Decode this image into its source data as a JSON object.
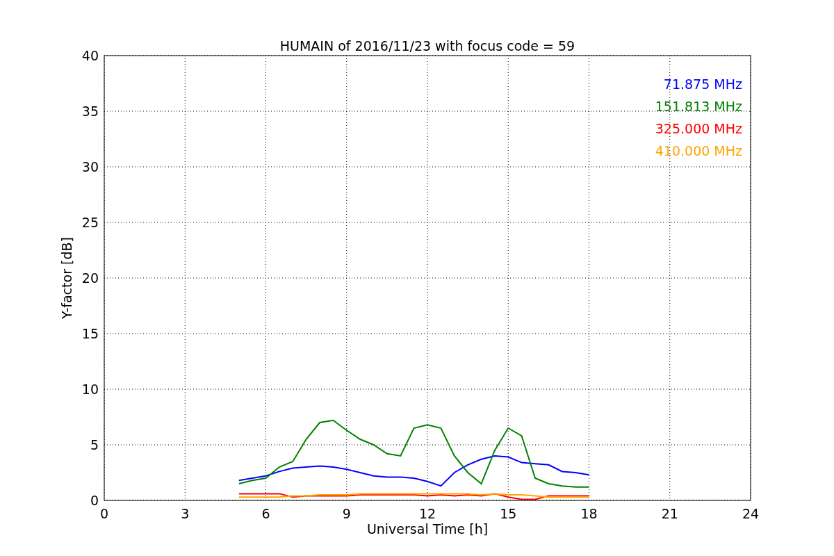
{
  "plot": {
    "chart_data": {
      "type": "line",
      "title": "HUMAIN of 2016/11/23 with focus code = 59",
      "xlabel": "Universal Time [h]",
      "ylabel": "Y-factor [dB]",
      "x": [
        5,
        5.5,
        6,
        6.5,
        7,
        7.5,
        8,
        8.5,
        9,
        9.5,
        10,
        10.5,
        11,
        11.5,
        12,
        12.5,
        13,
        13.5,
        14,
        14.5,
        15,
        15.5,
        16,
        16.5,
        17,
        17.5,
        18
      ],
      "series": [
        {
          "name": "71.875 MHz",
          "color": "#0000ff",
          "values": [
            1.8,
            2.0,
            2.2,
            2.6,
            2.9,
            3.0,
            3.1,
            3.0,
            2.8,
            2.5,
            2.2,
            2.1,
            2.1,
            2.0,
            1.7,
            1.3,
            2.5,
            3.2,
            3.7,
            4.0,
            3.9,
            3.4,
            3.3,
            3.2,
            2.6,
            2.5,
            2.3
          ]
        },
        {
          "name": "151.813 MHz",
          "color": "#008000",
          "values": [
            1.5,
            1.8,
            2.0,
            3.0,
            3.5,
            5.5,
            7.0,
            7.2,
            6.3,
            5.5,
            5.0,
            4.2,
            4.0,
            6.5,
            6.8,
            6.5,
            4.0,
            2.5,
            1.5,
            4.5,
            6.5,
            5.8,
            2.0,
            1.5,
            1.3,
            1.2,
            1.2
          ]
        },
        {
          "name": "325.000 MHz",
          "color": "#ff0000",
          "values": [
            0.6,
            0.6,
            0.6,
            0.6,
            0.3,
            0.4,
            0.4,
            0.4,
            0.4,
            0.5,
            0.5,
            0.5,
            0.5,
            0.5,
            0.4,
            0.5,
            0.4,
            0.5,
            0.4,
            0.6,
            0.3,
            0.1,
            0.1,
            0.4,
            0.4,
            0.4,
            0.4
          ]
        },
        {
          "name": "410.000 MHz",
          "color": "#ffa500",
          "values": [
            0.3,
            0.3,
            0.3,
            0.3,
            0.4,
            0.4,
            0.5,
            0.5,
            0.5,
            0.6,
            0.6,
            0.6,
            0.6,
            0.6,
            0.6,
            0.6,
            0.6,
            0.6,
            0.5,
            0.6,
            0.5,
            0.5,
            0.4,
            0.3,
            0.3,
            0.3,
            0.3
          ]
        }
      ],
      "xlim": [
        0,
        24
      ],
      "ylim": [
        0,
        40
      ],
      "xticks": [
        0,
        3,
        6,
        9,
        12,
        15,
        18,
        21,
        24
      ],
      "yticks": [
        0,
        5,
        10,
        15,
        20,
        25,
        30,
        35,
        40
      ],
      "grid": true
    }
  }
}
